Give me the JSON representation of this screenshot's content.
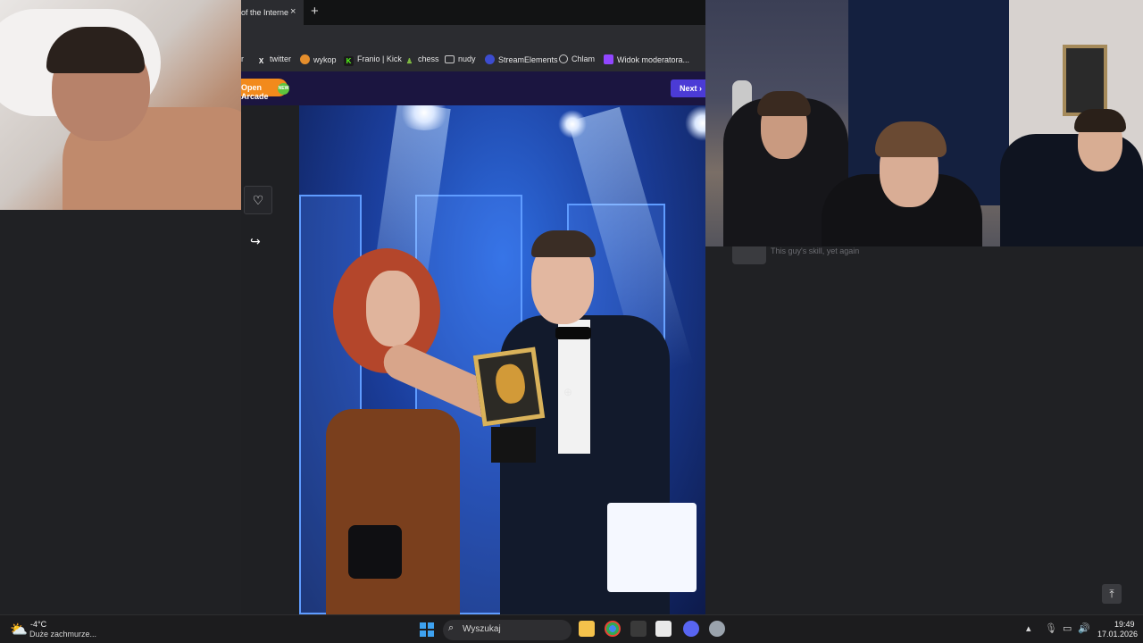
{
  "browser": {
    "tab_title": "of the Interne",
    "tab_close": "×",
    "new_tab": "+",
    "bookmarks": [
      {
        "label": "r",
        "icon": "bookmark-icon"
      },
      {
        "label": "twitter",
        "icon": "x-twitter-icon"
      },
      {
        "label": "wykop",
        "icon": "wykop-icon"
      },
      {
        "label": "Franio | Kick",
        "icon": "kick-icon"
      },
      {
        "label": "chess",
        "icon": "chess-pawn-icon"
      },
      {
        "label": "nudy",
        "icon": "folder-icon"
      },
      {
        "label": "StreamElements",
        "icon": "streamelements-icon"
      },
      {
        "label": "Chlam",
        "icon": "globe-icon"
      },
      {
        "label": "Widok moderatora...",
        "icon": "twitch-icon"
      }
    ]
  },
  "page": {
    "open_arcade_label": "Open Arcade",
    "arcade_badge": "NEW",
    "next_label": "Next",
    "next_arrow": "›",
    "like_icon": "♡",
    "share_icon": "↪"
  },
  "comment": {
    "text": "This guy's skill, yet again"
  },
  "scroll_top_icon": "⤒",
  "taskbar": {
    "weather_temp": "-4°C",
    "weather_desc": "Duże zachmurze...",
    "search_placeholder": "Wyszukaj",
    "clock_time": "19:49",
    "clock_date": "17.01.2026"
  },
  "colors": {
    "accent_next": "#4b3bd6",
    "accent_arcade": "#f28a1c",
    "windows_blue": "#3ea2f0"
  }
}
